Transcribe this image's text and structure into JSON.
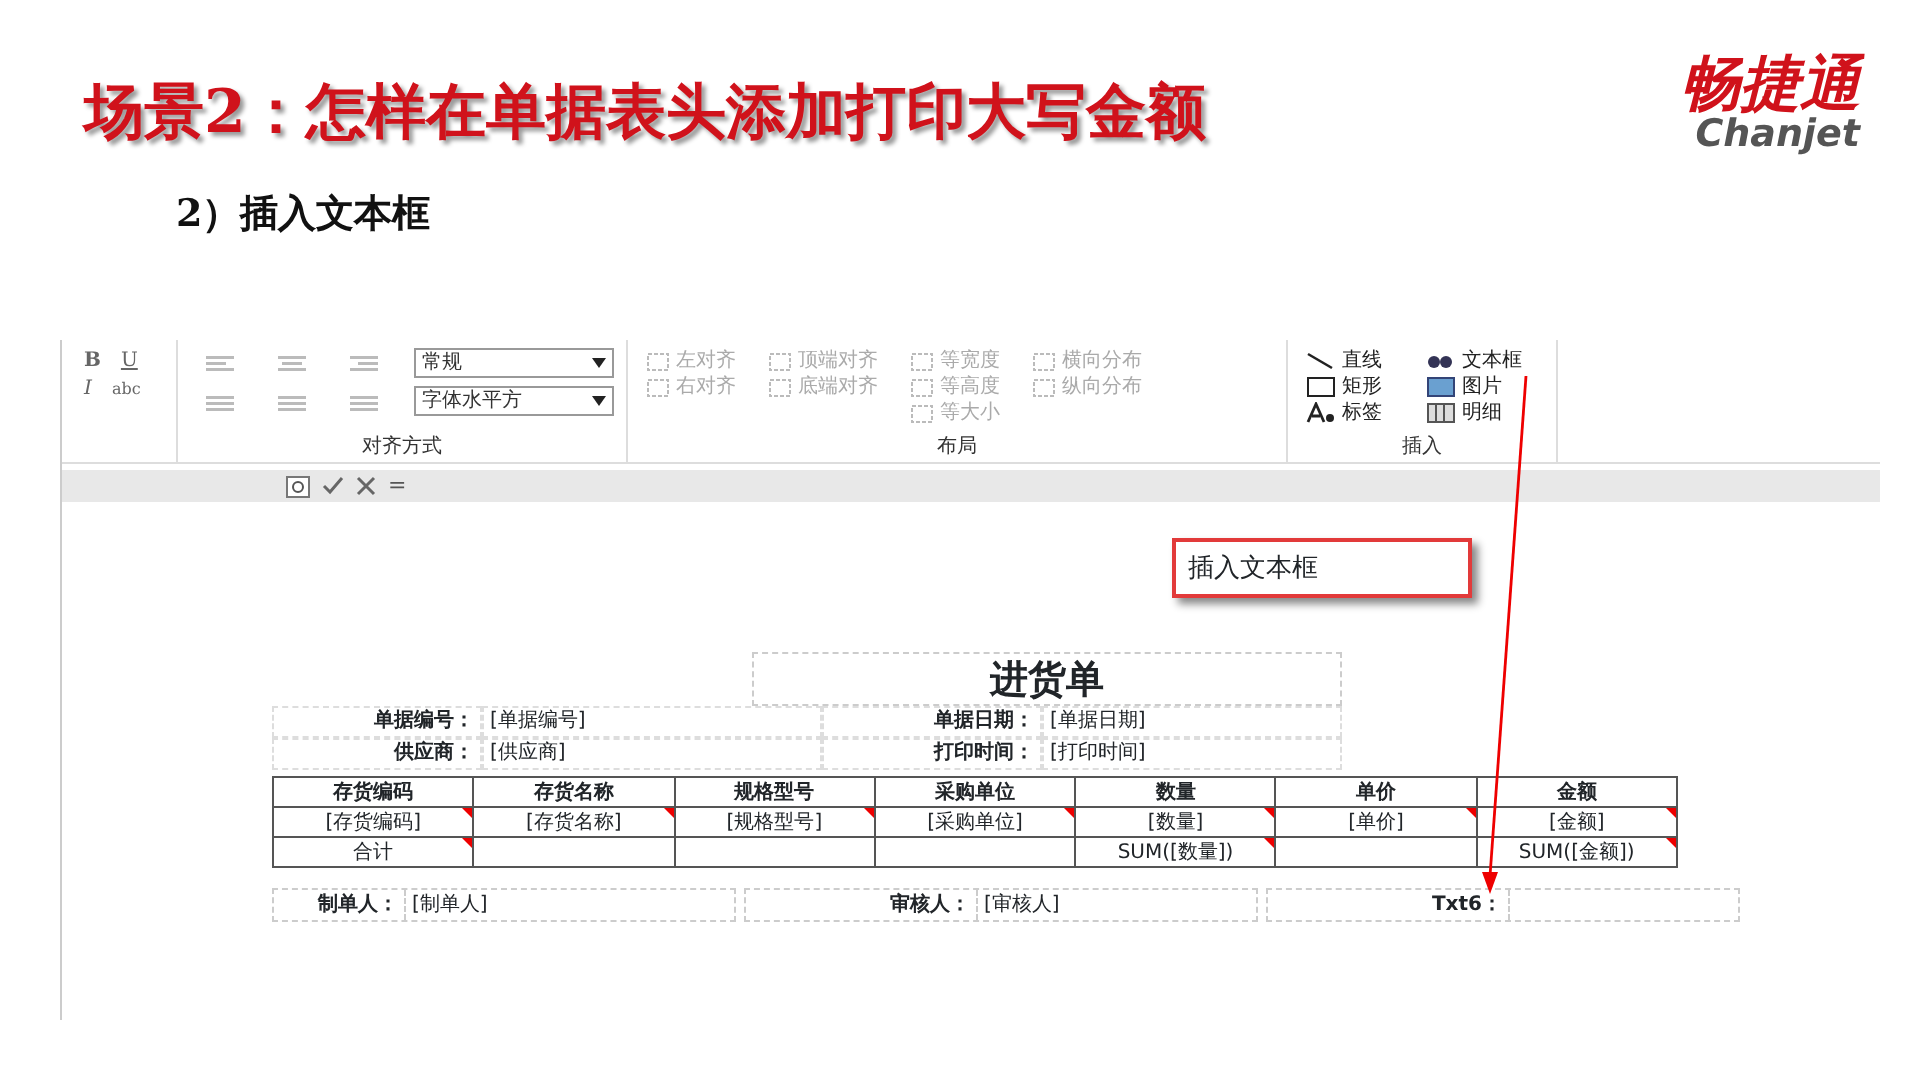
{
  "slide": {
    "title": "场景2：怎样在单据表头添加打印大写金额",
    "subtitle": "2）插入文本框",
    "logo": {
      "text": "畅捷通",
      "latin": "Chanjet"
    }
  },
  "ribbon": {
    "font_buttons": [
      {
        "label": "B",
        "kind": "bold"
      },
      {
        "label": "U",
        "kind": "underline"
      },
      {
        "label": "I",
        "kind": "italic"
      },
      {
        "label": "abc",
        "kind": "strike"
      }
    ],
    "align_group": {
      "label": "对齐方式",
      "dropdowns": [
        {
          "value": "常规"
        },
        {
          "value": "字体水平方"
        }
      ]
    },
    "layout_group": {
      "label": "布局",
      "items": [
        {
          "label": "左对齐",
          "disabled": true
        },
        {
          "label": "右对齐",
          "disabled": true
        },
        {
          "label": "顶端对齐",
          "disabled": true
        },
        {
          "label": "底端对齐",
          "disabled": true
        },
        {
          "label": "等宽度",
          "disabled": true
        },
        {
          "label": "等高度",
          "disabled": true
        },
        {
          "label": "等大小",
          "disabled": true
        },
        {
          "label": "横向分布",
          "disabled": true
        },
        {
          "label": "纵向分布",
          "disabled": true
        }
      ]
    },
    "insert_group": {
      "label": "插入",
      "items": [
        {
          "label": "直线",
          "kind": "line"
        },
        {
          "label": "矩形",
          "kind": "rect"
        },
        {
          "label": "标签",
          "kind": "label"
        },
        {
          "label": "文本框",
          "kind": "textbox"
        },
        {
          "label": "图片",
          "kind": "picture"
        },
        {
          "label": "明细",
          "kind": "detail"
        }
      ]
    }
  },
  "formula_bar": {
    "equals": "="
  },
  "callout": {
    "text": "插入文本框"
  },
  "form": {
    "title": "进货单",
    "header_rows": [
      [
        {
          "label": "单据编号：",
          "value": "[单据编号]"
        },
        {
          "label": "单据日期：",
          "value": "[单据日期]"
        }
      ],
      [
        {
          "label": "供应商：",
          "value": "[供应商]"
        },
        {
          "label": "打印时间：",
          "value": "[打印时间]"
        }
      ]
    ],
    "columns": [
      "存货编码",
      "存货名称",
      "规格型号",
      "采购单位",
      "数量",
      "单价",
      "金额"
    ],
    "rows": [
      {
        "cells": [
          {
            "text": "[存货编码]",
            "marked": true
          },
          {
            "text": "[存货名称]",
            "marked": true
          },
          {
            "text": "[规格型号]",
            "marked": true
          },
          {
            "text": "[采购单位]",
            "marked": true
          },
          {
            "text": "[数量]",
            "marked": true
          },
          {
            "text": "[单价]",
            "marked": true
          },
          {
            "text": "[金额]",
            "marked": true
          }
        ]
      },
      {
        "cells": [
          {
            "text": "合计",
            "marked": true
          },
          {
            "text": "",
            "marked": false
          },
          {
            "text": "",
            "marked": false
          },
          {
            "text": "",
            "marked": false
          },
          {
            "text": "SUM([数量])",
            "marked": true
          },
          {
            "text": "",
            "marked": false
          },
          {
            "text": "SUM([金额])",
            "marked": true
          }
        ]
      }
    ],
    "footer_fields": [
      {
        "label": "制单人：",
        "value": "[制单人]"
      },
      {
        "label": "审核人：",
        "value": "[审核人]"
      },
      {
        "label": "Txt6："
      }
    ]
  }
}
